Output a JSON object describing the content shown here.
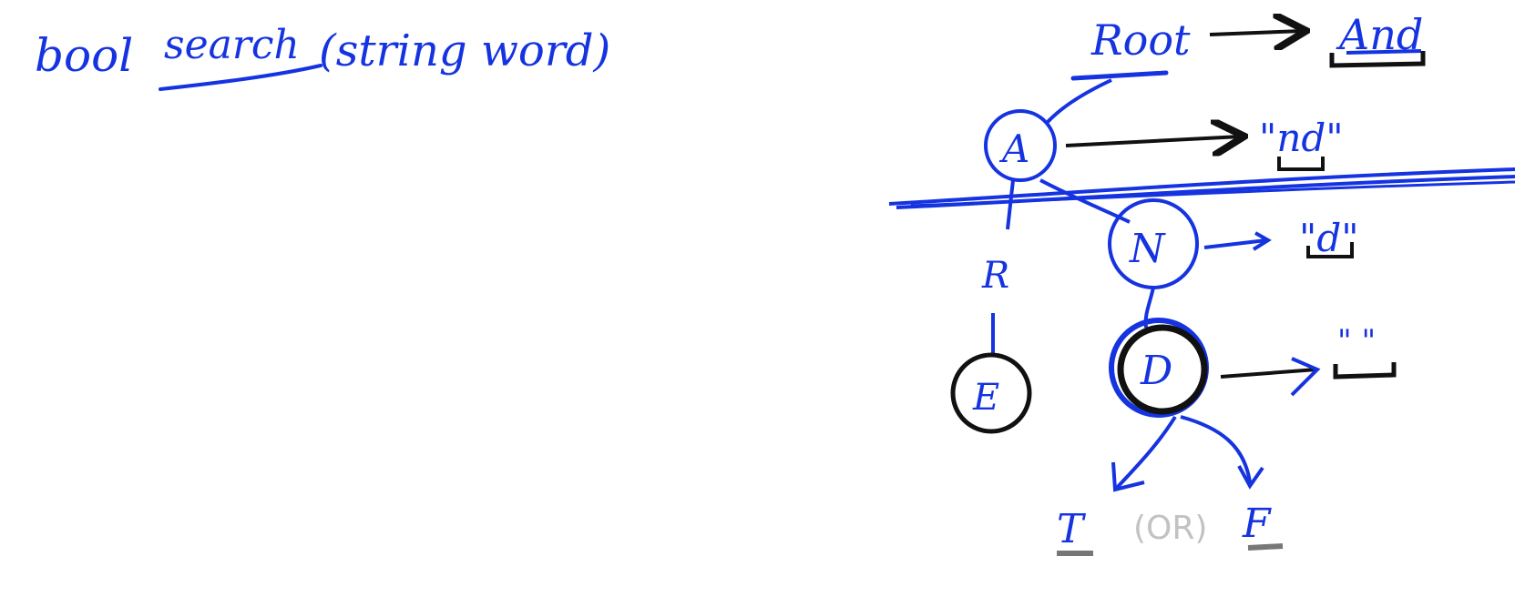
{
  "colors": {
    "ink_blue": "#1533e0",
    "ink_black": "#111111",
    "ink_grey": "#c2c2c2",
    "background": "#ffffff"
  },
  "signature": {
    "return_type": "bool",
    "function_name": "search",
    "params": "(string word)"
  },
  "trie": {
    "root_label": "Root",
    "root_word": "And",
    "nodes": [
      {
        "id": "A",
        "label": "A",
        "remaining": "\"nd\""
      },
      {
        "id": "N",
        "label": "N",
        "remaining": "\"d\""
      },
      {
        "id": "D",
        "label": "D",
        "remaining": "\" \""
      },
      {
        "id": "R",
        "label": "R"
      },
      {
        "id": "E",
        "label": "E"
      }
    ],
    "outcomes": {
      "true_label": "T",
      "or_label": "(OR)",
      "false_label": "F"
    }
  }
}
